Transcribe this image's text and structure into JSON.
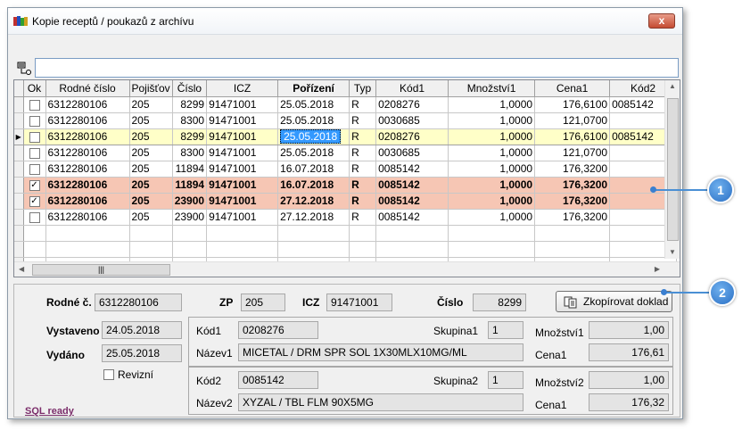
{
  "window": {
    "title": "Kopie receptů / poukazů z archívu",
    "close_label": "x"
  },
  "filter": {
    "value": ""
  },
  "grid": {
    "columns": [
      "Ok",
      "Rodné číslo",
      "Pojišťov",
      "Číslo",
      "ICZ",
      "Pořízení",
      "Typ",
      "Kód1",
      "Množství1",
      "Cena1",
      "Kód2"
    ],
    "rows": [
      {
        "ok": false,
        "rc": "6312280106",
        "poj": "205",
        "cislo": "8299",
        "icz": "91471001",
        "por": "25.05.2018",
        "typ": "R",
        "kod1": "0208276",
        "mn1": "1,0000",
        "cena1": "176,6100",
        "kod2": "0085142"
      },
      {
        "ok": false,
        "rc": "6312280106",
        "poj": "205",
        "cislo": "8300",
        "icz": "91471001",
        "por": "25.05.2018",
        "typ": "R",
        "kod1": "0030685",
        "mn1": "1,0000",
        "cena1": "121,0700",
        "kod2": ""
      },
      {
        "ok": false,
        "rc": "6312280106",
        "poj": "205",
        "cislo": "8299",
        "icz": "91471001",
        "por": "25.05.2018",
        "typ": "R",
        "kod1": "0208276",
        "mn1": "1,0000",
        "cena1": "176,6100",
        "kod2": "0085142"
      },
      {
        "ok": false,
        "rc": "6312280106",
        "poj": "205",
        "cislo": "8300",
        "icz": "91471001",
        "por": "25.05.2018",
        "typ": "R",
        "kod1": "0030685",
        "mn1": "1,0000",
        "cena1": "121,0700",
        "kod2": ""
      },
      {
        "ok": false,
        "rc": "6312280106",
        "poj": "205",
        "cislo": "11894",
        "icz": "91471001",
        "por": "16.07.2018",
        "typ": "R",
        "kod1": "0085142",
        "mn1": "1,0000",
        "cena1": "176,3200",
        "kod2": ""
      },
      {
        "ok": true,
        "rc": "6312280106",
        "poj": "205",
        "cislo": "11894",
        "icz": "91471001",
        "por": "16.07.2018",
        "typ": "R",
        "kod1": "0085142",
        "mn1": "1,0000",
        "cena1": "176,3200",
        "kod2": ""
      },
      {
        "ok": true,
        "rc": "6312280106",
        "poj": "205",
        "cislo": "23900",
        "icz": "91471001",
        "por": "27.12.2018",
        "typ": "R",
        "kod1": "0085142",
        "mn1": "1,0000",
        "cena1": "176,3200",
        "kod2": ""
      },
      {
        "ok": false,
        "rc": "6312280106",
        "poj": "205",
        "cislo": "23900",
        "icz": "91471001",
        "por": "27.12.2018",
        "typ": "R",
        "kod1": "0085142",
        "mn1": "1,0000",
        "cena1": "176,3200",
        "kod2": ""
      }
    ]
  },
  "detail": {
    "rodne_label": "Rodné č.",
    "rodne_value": "6312280106",
    "zp_label": "ZP",
    "zp_value": "205",
    "icz_label": "ICZ",
    "icz_value": "91471001",
    "cislo_label": "Číslo",
    "cislo_value": "8299",
    "copy_label": "Zkopírovat doklad",
    "vystaveno_label": "Vystaveno",
    "vystaveno_value": "24.05.2018",
    "vydano_label": "Vydáno",
    "vydano_value": "25.05.2018",
    "revizni_label": "Revizní",
    "kod1_label": "Kód1",
    "kod1_value": "0208276",
    "skupina1_label": "Skupina1",
    "skupina1_value": "1",
    "mnozstvi1_label": "Množství1",
    "mnozstvi1_value": "1,00",
    "nazev1_label": "Název1",
    "nazev1_value": "MICETAL / DRM SPR SOL 1X30MLX10MG/ML",
    "cena1_label": "Cena1",
    "cena1_value": "176,61",
    "kod2_label": "Kód2",
    "kod2_value": "0085142",
    "skupina2_label": "Skupina2",
    "skupina2_value": "1",
    "mnozstvi2_label": "Množství2",
    "mnozstvi2_value": "1,00",
    "nazev2_label": "Název2",
    "nazev2_value": "XYZAL / TBL FLM 90X5MG",
    "cena2_label": "Cena1",
    "cena2_value": "176,32",
    "sql_status": "SQL ready"
  },
  "callouts": [
    "1",
    "2"
  ],
  "colors": {
    "highlight_row": "#ffffc8",
    "checked_row": "#f6c6b4",
    "callout": "#2a6fc4"
  }
}
